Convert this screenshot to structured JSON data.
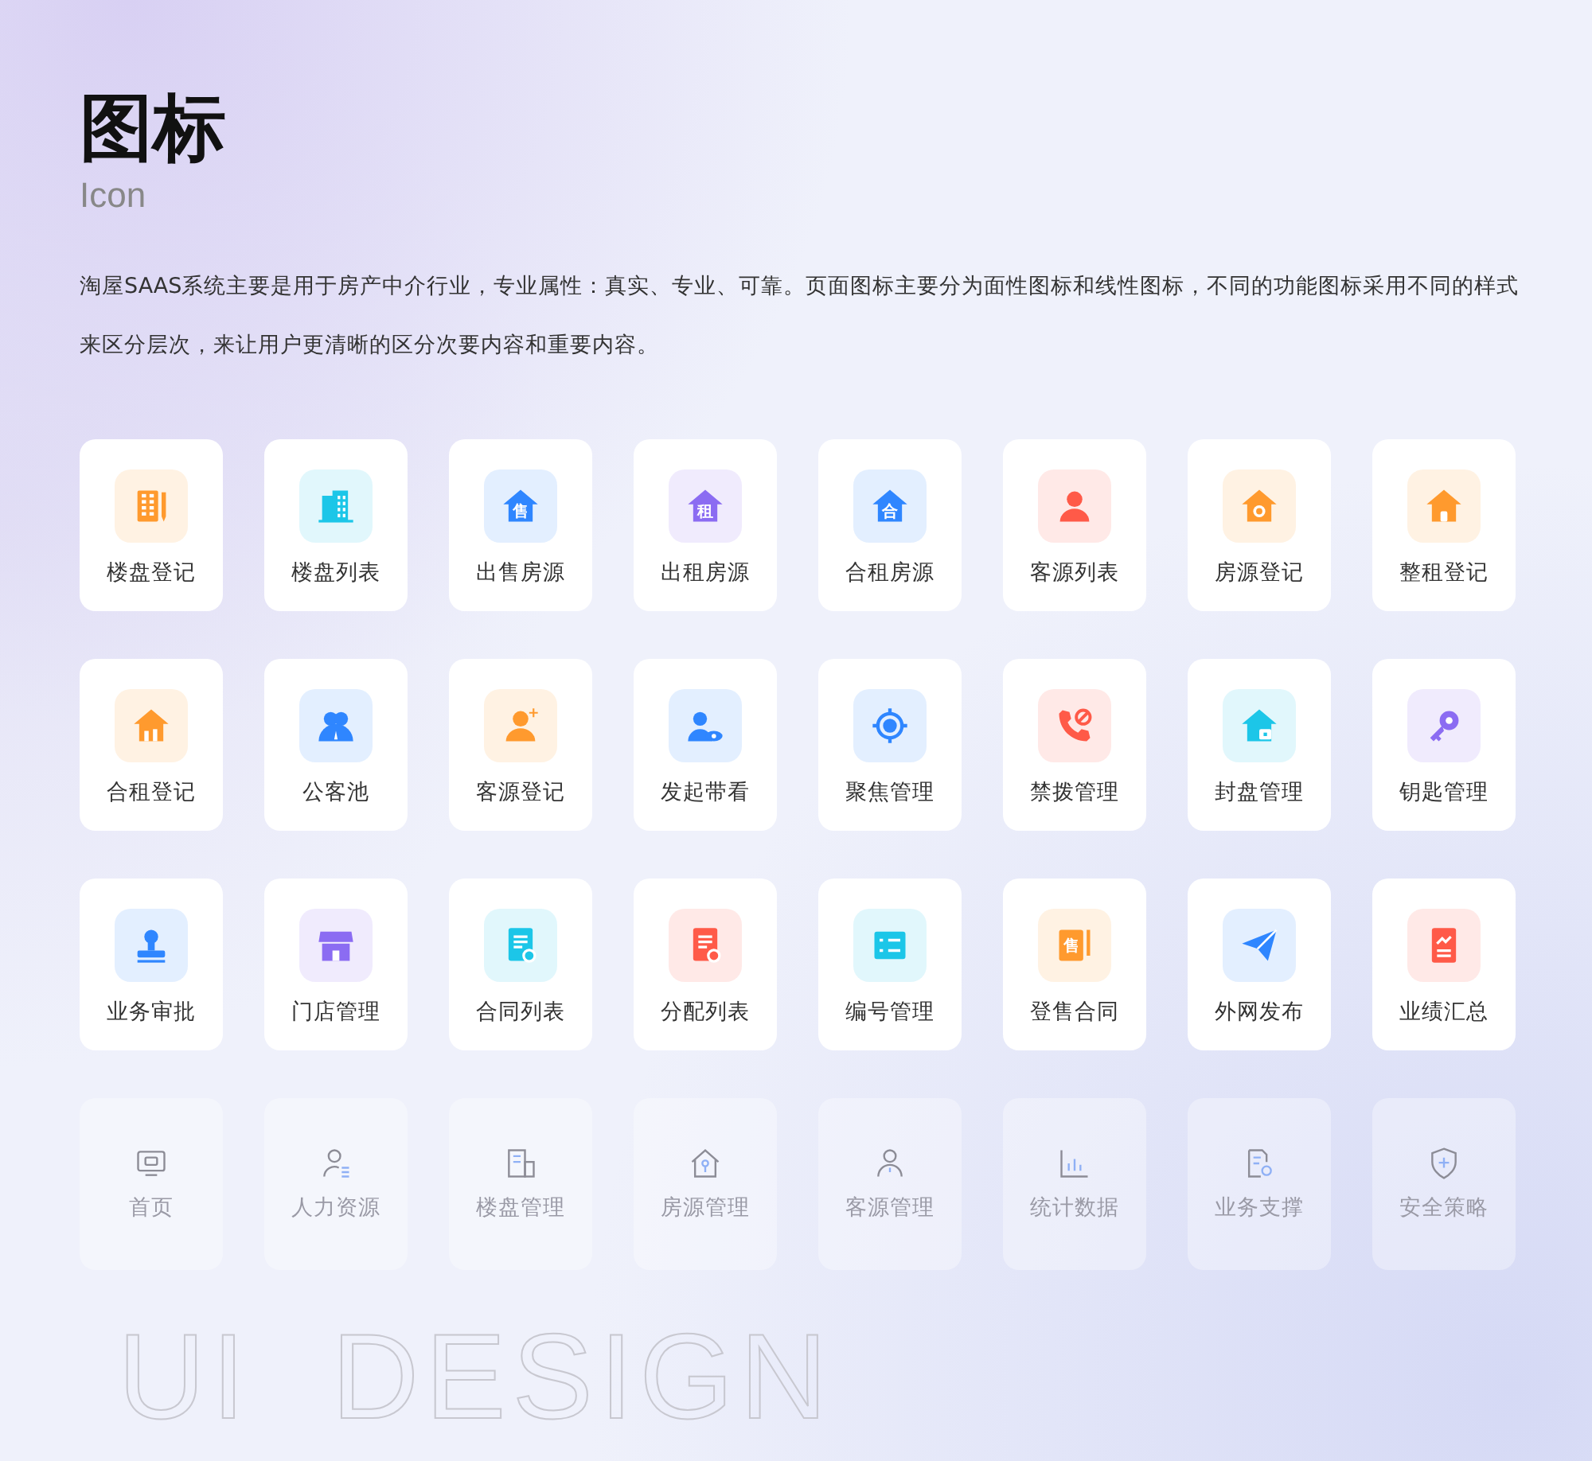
{
  "title": "图标",
  "subtitle": "Icon",
  "description": "淘屋SAAS系统主要是用于房产中介行业，专业属性：真实、专业、可靠。页面图标主要分为面性图标和线性图标，不同的功能图标采用不同的样式来区分层次，来让用户更清晰的区分次要内容和重要内容。",
  "icons": [
    {
      "label": "楼盘登记",
      "kind": "filled",
      "color": "#ff9a2e"
    },
    {
      "label": "楼盘列表",
      "kind": "filled",
      "color": "#1cc6e8"
    },
    {
      "label": "出售房源",
      "kind": "filled",
      "color": "#2f86ff",
      "glyph": "售"
    },
    {
      "label": "出租房源",
      "kind": "filled",
      "color": "#8b6cf2",
      "glyph": "租"
    },
    {
      "label": "合租房源",
      "kind": "filled",
      "color": "#2f86ff",
      "glyph": "合"
    },
    {
      "label": "客源列表",
      "kind": "filled",
      "color": "#ff5a48"
    },
    {
      "label": "房源登记",
      "kind": "filled",
      "color": "#ff9a2e"
    },
    {
      "label": "整租登记",
      "kind": "filled",
      "color": "#ff9a2e"
    },
    {
      "label": "合租登记",
      "kind": "filled",
      "color": "#ff9a2e"
    },
    {
      "label": "公客池",
      "kind": "filled",
      "color": "#2f86ff"
    },
    {
      "label": "客源登记",
      "kind": "filled",
      "color": "#ff9a2e"
    },
    {
      "label": "发起带看",
      "kind": "filled",
      "color": "#2f86ff"
    },
    {
      "label": "聚焦管理",
      "kind": "filled",
      "color": "#2f86ff"
    },
    {
      "label": "禁拨管理",
      "kind": "filled",
      "color": "#ff5a48"
    },
    {
      "label": "封盘管理",
      "kind": "filled",
      "color": "#1cc6e8"
    },
    {
      "label": "钥匙管理",
      "kind": "filled",
      "color": "#8b6cf2"
    },
    {
      "label": "业务审批",
      "kind": "filled",
      "color": "#2f86ff"
    },
    {
      "label": "门店管理",
      "kind": "filled",
      "color": "#8b6cf2"
    },
    {
      "label": "合同列表",
      "kind": "filled",
      "color": "#1cc6e8"
    },
    {
      "label": "分配列表",
      "kind": "filled",
      "color": "#ff5a48"
    },
    {
      "label": "编号管理",
      "kind": "filled",
      "color": "#1cc6e8"
    },
    {
      "label": "登售合同",
      "kind": "filled",
      "color": "#ff9a2e",
      "glyph": "售"
    },
    {
      "label": "外网发布",
      "kind": "filled",
      "color": "#2f86ff"
    },
    {
      "label": "业绩汇总",
      "kind": "filled",
      "color": "#ff5a48"
    },
    {
      "label": "首页",
      "kind": "line"
    },
    {
      "label": "人力资源",
      "kind": "line"
    },
    {
      "label": "楼盘管理",
      "kind": "line"
    },
    {
      "label": "房源管理",
      "kind": "line"
    },
    {
      "label": "客源管理",
      "kind": "line"
    },
    {
      "label": "统计数据",
      "kind": "line"
    },
    {
      "label": "业务支撑",
      "kind": "line"
    },
    {
      "label": "安全策略",
      "kind": "line"
    }
  ],
  "watermark_text": "UI  DESIGN"
}
